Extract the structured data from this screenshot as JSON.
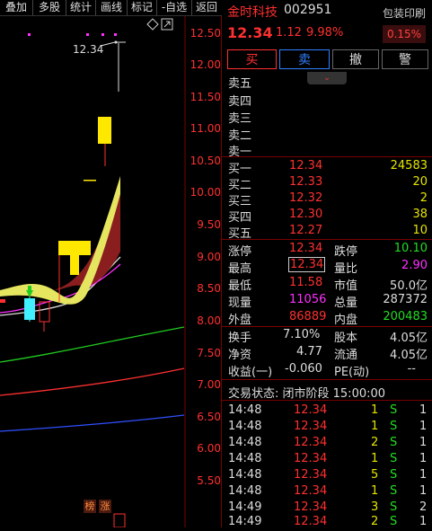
{
  "toolbar": {
    "items": [
      "叠加",
      "多股",
      "统计",
      "画线",
      "标记",
      "-自选",
      "返回"
    ]
  },
  "chart": {
    "price_labels": [
      "12.50",
      "12.00",
      "11.50",
      "11.00",
      "10.50",
      "10.00",
      "9.50",
      "9.00",
      "8.50",
      "8.00",
      "7.50",
      "7.00",
      "6.50",
      "6.00",
      "5.50"
    ],
    "high_marker": "12.34",
    "badges": [
      "榜",
      "涨"
    ],
    "icon_diamond": "diamond-icon",
    "icon_expand": "expand-icon"
  },
  "stock": {
    "name": "金时科技",
    "code": "002951",
    "price": "12.34",
    "change": "1.12",
    "change_pct": "9.98%",
    "print_label": "包装印刷",
    "print_pct": "0.15%"
  },
  "actions": {
    "buy": "买",
    "sell": "卖",
    "cancel": "撤",
    "alert": "警"
  },
  "sell_book": [
    {
      "label": "卖五",
      "price": "",
      "vol": ""
    },
    {
      "label": "卖四",
      "price": "",
      "vol": ""
    },
    {
      "label": "卖三",
      "price": "",
      "vol": ""
    },
    {
      "label": "卖二",
      "price": "",
      "vol": ""
    },
    {
      "label": "卖一",
      "price": "",
      "vol": ""
    }
  ],
  "buy_book": [
    {
      "label": "买一",
      "price": "12.34",
      "vol": "24583"
    },
    {
      "label": "买二",
      "price": "12.33",
      "vol": "20"
    },
    {
      "label": "买三",
      "price": "12.32",
      "vol": "2"
    },
    {
      "label": "买四",
      "price": "12.30",
      "vol": "38"
    },
    {
      "label": "买五",
      "price": "12.27",
      "vol": "10"
    }
  ],
  "stats": [
    {
      "l1": "涨停",
      "v1": "12.34",
      "l2": "跌停",
      "v2": "10.10"
    },
    {
      "l1": "最高",
      "v1": "12.34",
      "l2": "量比",
      "v2": "2.90"
    },
    {
      "l1": "最低",
      "v1": "11.58",
      "l2": "市值",
      "v2": "50.0亿"
    },
    {
      "l1": "现量",
      "v1": "11056",
      "l2": "总量",
      "v2": "287372"
    },
    {
      "l1": "外盘",
      "v1": "86889",
      "l2": "内盘",
      "v2": "200483"
    }
  ],
  "fundamentals": [
    {
      "l1": "换手",
      "v1": "7.10%",
      "l2": "股本",
      "v2": "4.05亿"
    },
    {
      "l1": "净资",
      "v1": "4.77",
      "l2": "流通",
      "v2": "4.05亿"
    },
    {
      "l1": "收益(一)",
      "v1": "-0.060",
      "l2": "PE(动)",
      "v2": "--"
    }
  ],
  "trade_status": "交易状态: 闭市阶段 15:00:00",
  "ticks": [
    {
      "time": "14:48",
      "price": "12.34",
      "vol": "1",
      "side": "S",
      "n": "1"
    },
    {
      "time": "14:48",
      "price": "12.34",
      "vol": "1",
      "side": "S",
      "n": "1"
    },
    {
      "time": "14:48",
      "price": "12.34",
      "vol": "2",
      "side": "S",
      "n": "1"
    },
    {
      "time": "14:48",
      "price": "12.34",
      "vol": "1",
      "side": "S",
      "n": "1"
    },
    {
      "time": "14:48",
      "price": "12.34",
      "vol": "5",
      "side": "S",
      "n": "1"
    },
    {
      "time": "14:48",
      "price": "12.34",
      "vol": "1",
      "side": "S",
      "n": "1"
    },
    {
      "time": "14:49",
      "price": "12.34",
      "vol": "3",
      "side": "S",
      "n": "2"
    },
    {
      "time": "14:49",
      "price": "12.34",
      "vol": "2",
      "side": "S",
      "n": "1"
    }
  ]
}
